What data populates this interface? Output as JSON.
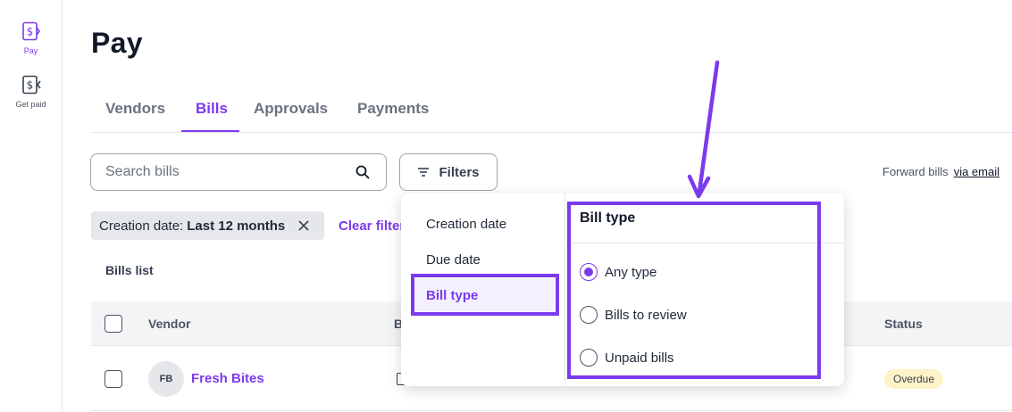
{
  "sidebar": {
    "items": [
      {
        "label": "Pay",
        "icon": "pay-icon",
        "active": true
      },
      {
        "label": "Get paid",
        "icon": "get-paid-icon",
        "active": false
      }
    ]
  },
  "page": {
    "title": "Pay"
  },
  "tabs": [
    {
      "label": "Vendors",
      "active": false
    },
    {
      "label": "Bills",
      "active": true
    },
    {
      "label": "Approvals",
      "active": false
    },
    {
      "label": "Payments",
      "active": false
    }
  ],
  "toolbar": {
    "search_placeholder": "Search bills",
    "filters_label": "Filters",
    "forward_text": "Forward bills",
    "forward_link": "via email"
  },
  "active_filter": {
    "name": "Creation date:",
    "value": "Last 12 months",
    "clear_label": "Clear filters"
  },
  "bills_list": {
    "title": "Bills list",
    "columns": {
      "vendor": "Vendor",
      "bill": "B",
      "status": "Status"
    },
    "rows": [
      {
        "initials": "FB",
        "vendor": "Fresh Bites",
        "status": "Overdue"
      }
    ]
  },
  "filter_menu": {
    "categories": [
      {
        "label": "Creation date",
        "active": false
      },
      {
        "label": "Due date",
        "active": false
      },
      {
        "label": "Bill type",
        "active": true
      }
    ],
    "panel_title": "Bill type",
    "options": [
      {
        "label": "Any type",
        "checked": true
      },
      {
        "label": "Bills to review",
        "checked": false
      },
      {
        "label": "Unpaid bills",
        "checked": false
      }
    ]
  },
  "colors": {
    "accent": "#7c3aed",
    "status_overdue_bg": "#fef3c7",
    "chip_bg": "#e5e7eb"
  }
}
